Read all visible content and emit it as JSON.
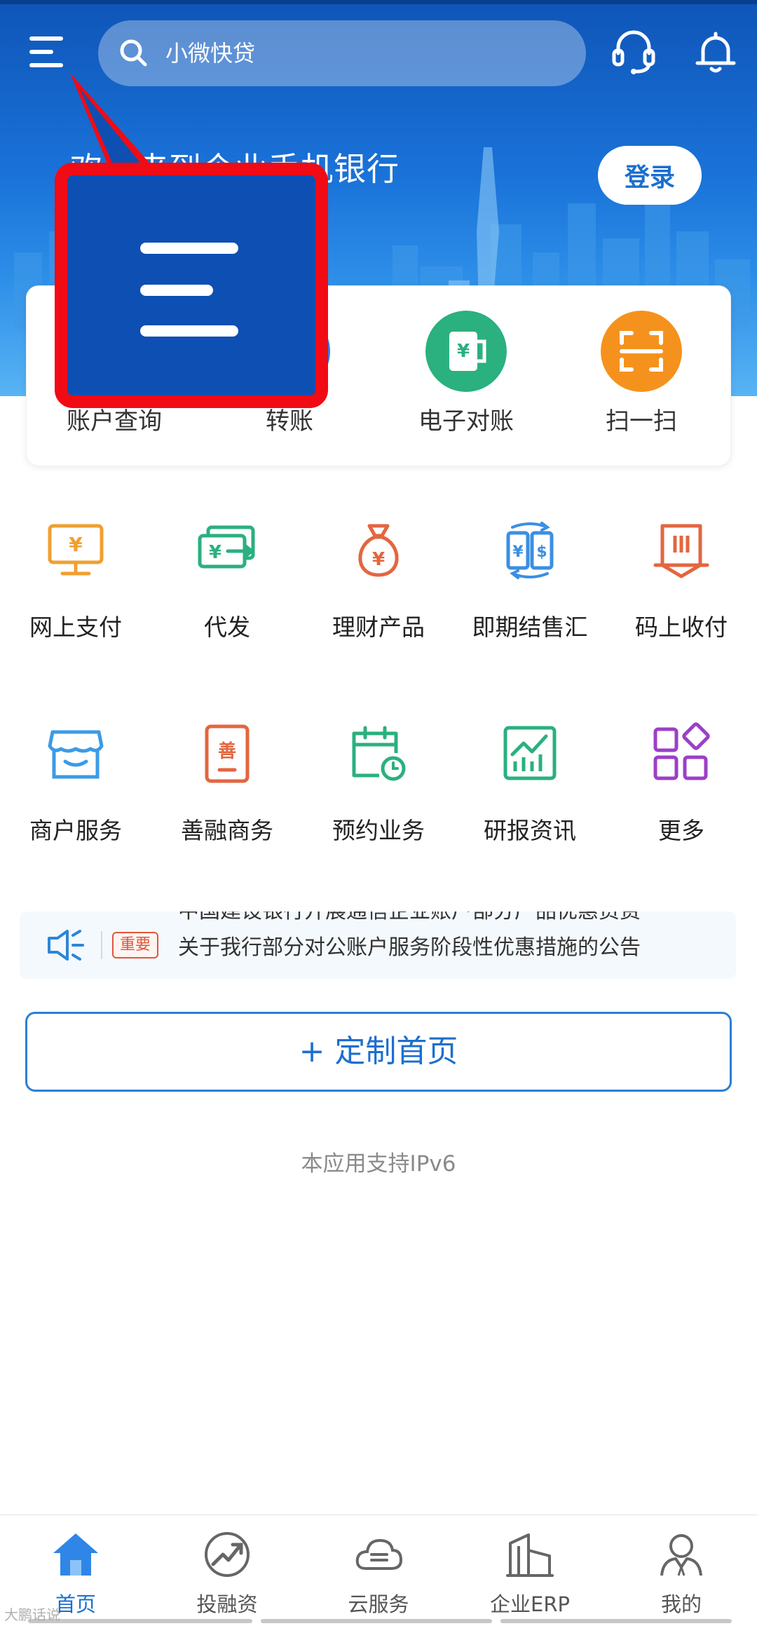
{
  "header": {
    "search_placeholder": "小微快贷",
    "welcome_text": "欢迎来到企业手机银行",
    "login_label": "登录"
  },
  "quick_actions": [
    {
      "label": "账户查询",
      "icon": "account-query-icon"
    },
    {
      "label": "转账",
      "icon": "transfer-icon"
    },
    {
      "label": "电子对账",
      "icon": "e-reconciliation-icon",
      "color": "#2bb07f"
    },
    {
      "label": "扫一扫",
      "icon": "scan-icon",
      "color": "#f5921e"
    }
  ],
  "services": [
    {
      "label": "网上支付",
      "icon": "online-payment-icon"
    },
    {
      "label": "代发",
      "icon": "payroll-icon"
    },
    {
      "label": "理财产品",
      "icon": "wealth-product-icon"
    },
    {
      "label": "即期结售汇",
      "icon": "fx-settlement-icon"
    },
    {
      "label": "码上收付",
      "icon": "qr-collect-pay-icon"
    },
    {
      "label": "商户服务",
      "icon": "merchant-service-icon"
    },
    {
      "label": "善融商务",
      "icon": "shanrong-commerce-icon"
    },
    {
      "label": "预约业务",
      "icon": "appointment-icon"
    },
    {
      "label": "研报资讯",
      "icon": "research-report-icon"
    },
    {
      "label": "更多",
      "icon": "more-icon"
    }
  ],
  "notice": {
    "tag": "重要",
    "previous_line": "中国建设银行开展通信企业账户部分产品优惠资费",
    "text": "关于我行部分对公账户服务阶段性优惠措施的公告"
  },
  "customize_label": "+ 定制首页",
  "footer_note": "本应用支持IPv6",
  "tabbar": [
    {
      "label": "首页",
      "icon": "home-icon",
      "active": true
    },
    {
      "label": "投融资",
      "icon": "investment-icon",
      "active": false
    },
    {
      "label": "云服务",
      "icon": "cloud-service-icon",
      "active": false
    },
    {
      "label": "企业ERP",
      "icon": "erp-icon",
      "active": false
    },
    {
      "label": "我的",
      "icon": "profile-icon",
      "active": false
    }
  ],
  "watermark": "大鹏话说",
  "colors": {
    "brand_blue": "#1b6fcf",
    "highlight_red": "#f10b14",
    "green": "#2bb07f",
    "orange": "#f5921e"
  }
}
